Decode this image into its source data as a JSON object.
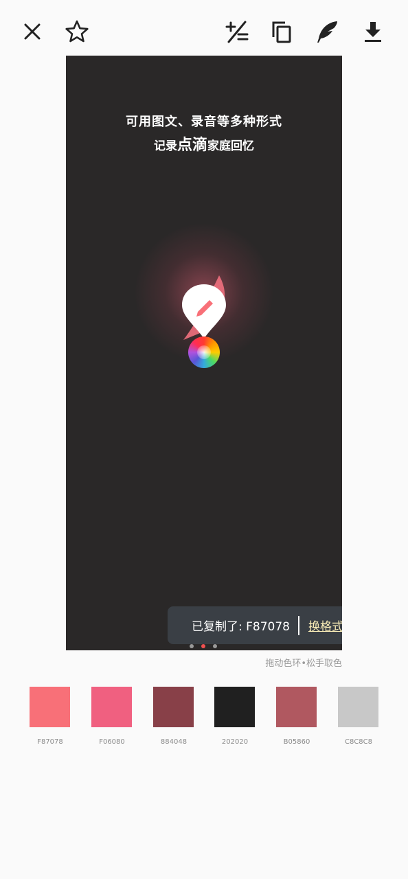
{
  "toolbar": {
    "icons": [
      "close-icon",
      "star-icon",
      "plus-minus-icon",
      "copy-icon",
      "feather-icon",
      "download-icon"
    ]
  },
  "preview": {
    "promo_line1": "可用图文、录音等多种形式",
    "promo_line2_prefix": "记录",
    "promo_line2_emphasis": "点滴",
    "promo_line2_suffix": "家庭回忆",
    "logo_color": "#ffffff",
    "accent_color": "#f87078"
  },
  "toast": {
    "message": "已复制了: F87078",
    "action": "换格式"
  },
  "pager": {
    "count": 3,
    "active": 2
  },
  "hint": "拖动色环•松手取色",
  "palette": [
    {
      "hex": "#F87078",
      "code": "F87078"
    },
    {
      "hex": "#F06080",
      "code": "F06080"
    },
    {
      "hex": "#884048",
      "code": "884048"
    },
    {
      "hex": "#202020",
      "code": "202020"
    },
    {
      "hex": "#B05860",
      "code": "B05860"
    },
    {
      "hex": "#C8C8C8",
      "code": "C8C8C8"
    }
  ]
}
